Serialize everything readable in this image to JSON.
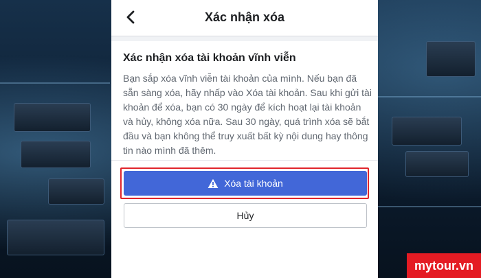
{
  "nav": {
    "title": "Xác nhận xóa",
    "back_icon": "chevron-left-icon"
  },
  "card": {
    "title": "Xác nhận xóa tài khoản vĩnh viễn",
    "body": "Bạn sắp xóa vĩnh viễn tài khoản của mình. Nếu bạn đã sẵn sàng xóa, hãy nhấp vào Xóa tài khoản. Sau khi gửi tài khoản để xóa, bạn có 30 ngày để kích hoạt lại tài khoản và hủy, không xóa nữa. Sau 30 ngày, quá trình xóa sẽ bắt đầu và bạn không thể truy xuất bất kỳ nội dung hay thông tin nào mình đã thêm."
  },
  "actions": {
    "delete_label": "Xóa tài khoản",
    "delete_icon": "warning-icon",
    "cancel_label": "Hủy"
  },
  "watermark": {
    "text": "mytour.vn"
  },
  "colors": {
    "primary_button": "#4267d8",
    "highlight_border": "#e0242b",
    "watermark_bg": "#e41b23"
  }
}
